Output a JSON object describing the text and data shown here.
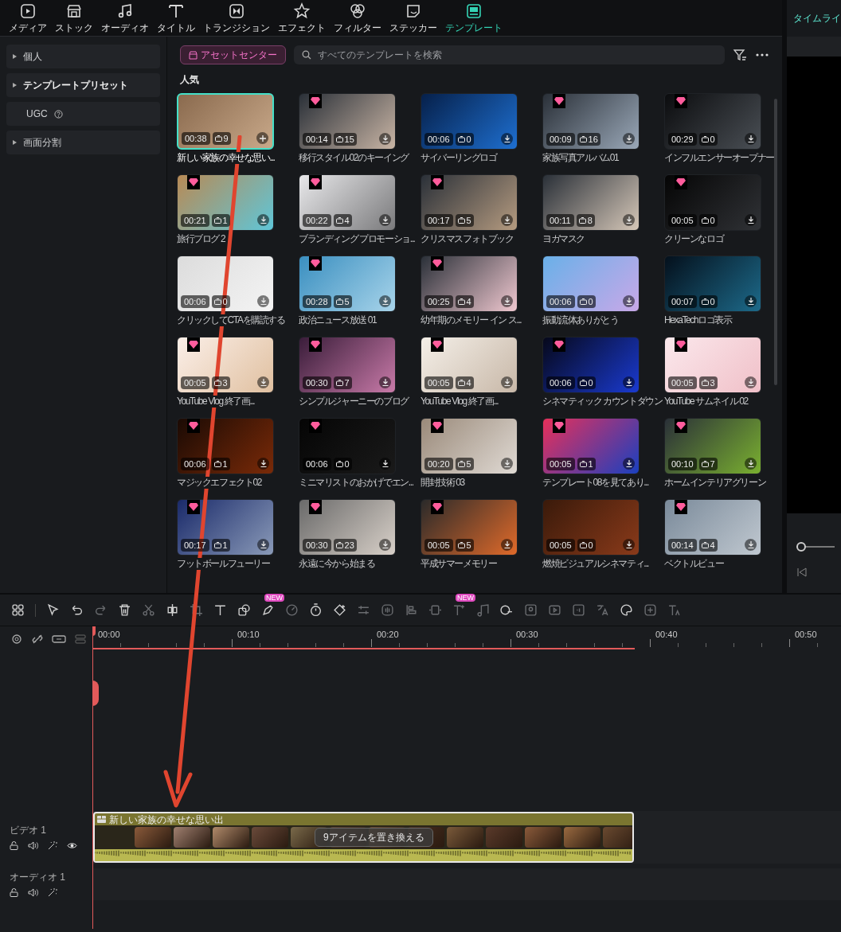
{
  "top_tabs": [
    {
      "label": "メディア",
      "selected": false
    },
    {
      "label": "ストック",
      "selected": false
    },
    {
      "label": "オーディオ",
      "selected": false
    },
    {
      "label": "タイトル",
      "selected": false
    },
    {
      "label": "トランジション",
      "selected": false
    },
    {
      "label": "エフェクト",
      "selected": false
    },
    {
      "label": "フィルター",
      "selected": false
    },
    {
      "label": "ステッカー",
      "selected": false
    },
    {
      "label": "テンプレート",
      "selected": true
    }
  ],
  "right_panel": {
    "title": "タイムライ",
    "zoom_slider": {
      "level": 0
    }
  },
  "sidebar": {
    "items": [
      {
        "label": "個人",
        "kind": "group",
        "selected": false
      },
      {
        "label": "テンプレートプリセット",
        "kind": "group",
        "selected": true
      },
      {
        "label": "UGC",
        "kind": "help",
        "selected": false
      },
      {
        "label": "画面分割",
        "kind": "group",
        "selected": false
      }
    ]
  },
  "asset_center_button": "アセットセンター",
  "search": {
    "placeholder": "すべてのテンプレートを検索"
  },
  "section_title": "人気",
  "templates": [
    {
      "title": "新しい家族の幸せな思い...",
      "duration": "00:38",
      "count": "9",
      "premium": false,
      "selected": true
    },
    {
      "title": "移行スタイル02のキーイング",
      "duration": "00:14",
      "count": "15",
      "premium": true,
      "selected": false
    },
    {
      "title": "サイバーリングロゴ",
      "duration": "00:06",
      "count": "0",
      "premium": false,
      "selected": false
    },
    {
      "title": "家族写真アルバム01",
      "duration": "00:09",
      "count": "16",
      "premium": true,
      "selected": false
    },
    {
      "title": "インフルエンサーオープナー",
      "duration": "00:29",
      "count": "0",
      "premium": true,
      "selected": false
    },
    {
      "title": "旅行ブログ 2",
      "duration": "00:21",
      "count": "1",
      "premium": true,
      "selected": false
    },
    {
      "title": "ブランディング プロモーショ...",
      "duration": "00:22",
      "count": "4",
      "premium": true,
      "selected": false
    },
    {
      "title": "クリスマスフォトブック",
      "duration": "00:17",
      "count": "5",
      "premium": true,
      "selected": false
    },
    {
      "title": "ヨガマスク",
      "duration": "00:11",
      "count": "8",
      "premium": false,
      "selected": false
    },
    {
      "title": "クリーンなロゴ",
      "duration": "00:05",
      "count": "0",
      "premium": true,
      "selected": false
    },
    {
      "title": "クリックしてCTAを購読する",
      "duration": "00:06",
      "count": "0",
      "premium": false,
      "selected": false
    },
    {
      "title": "政治ニュース放送 01",
      "duration": "00:28",
      "count": "5",
      "premium": true,
      "selected": false
    },
    {
      "title": "幼年期のメモリー イン ス...",
      "duration": "00:25",
      "count": "4",
      "premium": true,
      "selected": false
    },
    {
      "title": "振動流体ありがとう",
      "duration": "00:06",
      "count": "0",
      "premium": false,
      "selected": false
    },
    {
      "title": "HexaTechロゴ表示",
      "duration": "00:07",
      "count": "0",
      "premium": false,
      "selected": false
    },
    {
      "title": "YouTube Vlog 終了画...",
      "duration": "00:05",
      "count": "3",
      "premium": true,
      "selected": false
    },
    {
      "title": "シンプルジャーニーのブログ",
      "duration": "00:30",
      "count": "7",
      "premium": true,
      "selected": false
    },
    {
      "title": "YouTube Vlog 終了画...",
      "duration": "00:05",
      "count": "4",
      "premium": true,
      "selected": false
    },
    {
      "title": "シネマティック カウントダウン",
      "duration": "00:06",
      "count": "0",
      "premium": true,
      "selected": false
    },
    {
      "title": "YouTube サムネイル 02",
      "duration": "00:05",
      "count": "3",
      "premium": true,
      "selected": false
    },
    {
      "title": "マジックエフェクト02",
      "duration": "00:06",
      "count": "1",
      "premium": true,
      "selected": false
    },
    {
      "title": "ミニマリストのおかげでエン...",
      "duration": "00:06",
      "count": "0",
      "premium": true,
      "selected": false
    },
    {
      "title": "開封技術 03",
      "duration": "00:20",
      "count": "5",
      "premium": true,
      "selected": false
    },
    {
      "title": "テンプレート08を見てあり...",
      "duration": "00:05",
      "count": "1",
      "premium": true,
      "selected": false
    },
    {
      "title": "ホームインテリアグリーン",
      "duration": "00:10",
      "count": "7",
      "premium": true,
      "selected": false
    },
    {
      "title": "フットボールフューリー",
      "duration": "00:17",
      "count": "1",
      "premium": true,
      "selected": false
    },
    {
      "title": "永遠に今から始まる",
      "duration": "00:30",
      "count": "23",
      "premium": true,
      "selected": false
    },
    {
      "title": "平成サマーメモリー",
      "duration": "00:05",
      "count": "5",
      "premium": true,
      "selected": false
    },
    {
      "title": "燃焼ビジュアルシネマティ...",
      "duration": "00:05",
      "count": "0",
      "premium": false,
      "selected": false
    },
    {
      "title": "ベクトルビュー",
      "duration": "00:14",
      "count": "4",
      "premium": true,
      "selected": false
    }
  ],
  "timeline": {
    "toolbar_badges": [
      "NEW",
      "NEW"
    ],
    "ruler": [
      "00:00",
      "00:10",
      "00:20",
      "00:30",
      "00:40",
      "00:50"
    ],
    "tracks": [
      {
        "label": "ビデオ 1",
        "kind": "video"
      },
      {
        "label": "オーディオ 1",
        "kind": "audio"
      }
    ],
    "clip": {
      "title": "新しい家族の幸せな思い出",
      "overlay": "9アイテムを置き換える"
    }
  }
}
